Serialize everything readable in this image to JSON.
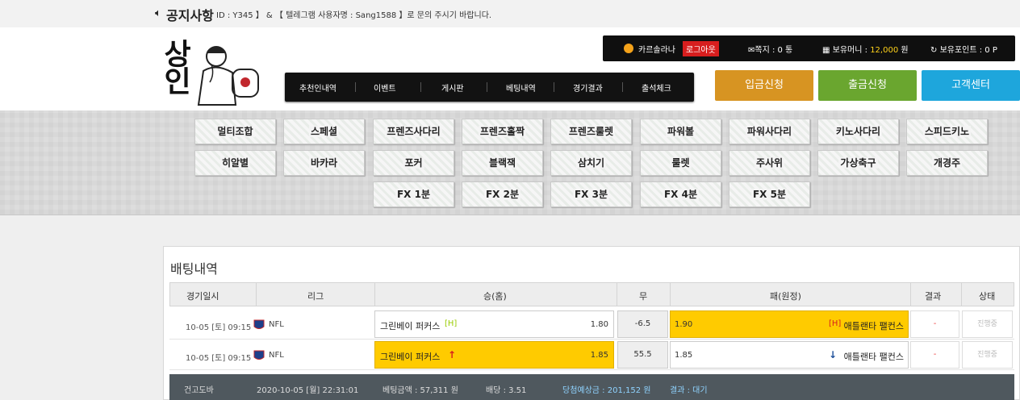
{
  "notice": {
    "icon": "speaker-icon",
    "title": "공지사항",
    "text": "ID : Y345 】 & 【 텔레그램 사용자명 : Sang1588 】로 문의 주시기 바랍니다."
  },
  "logo": {
    "text": "상인"
  },
  "userbar": {
    "username": "카르솔라나",
    "logout_label": "로그아웃",
    "message_label": "쪽지 : 0 통",
    "money_label": "보유머니 :",
    "money_value": "12,000",
    "money_unit": "원",
    "point_label": "보유포인트 : 0 P"
  },
  "menu": [
    "추천인내역",
    "이벤트",
    "게시판",
    "베팅내역",
    "경기결과",
    "출석체크"
  ],
  "actions": [
    {
      "label": "입금신청",
      "color": "#d79422"
    },
    {
      "label": "출금신청",
      "color": "#6aa62f"
    },
    {
      "label": "고객센터",
      "color": "#1ea6dc"
    }
  ],
  "games": [
    [
      "멀티조합",
      "스페셜",
      "프렌즈사다리",
      "프렌즈홀짝",
      "프렌즈룰렛",
      "파워볼",
      "파워사다리",
      "키노사다리",
      "스피드키노"
    ],
    [
      "히알별",
      "바카라",
      "포커",
      "블랙잭",
      "삼치기",
      "룰렛",
      "주사위",
      "가상축구",
      "개경주"
    ],
    [
      "FX 1분",
      "FX 2분",
      "FX 3분",
      "FX 4분",
      "FX 5분"
    ]
  ],
  "bet_history": {
    "title": "배팅내역",
    "columns": [
      "경기일시",
      "리그",
      "승(홈)",
      "무",
      "패(원정)",
      "결과",
      "상태"
    ],
    "rows": [
      {
        "date": "10-05 [토] 09:15",
        "league": "NFL",
        "home": "그린베이 퍼커스",
        "home_tag": "[H]",
        "home_odds": "1.80",
        "draw": "-6.5",
        "away_odds": "1.90",
        "away": "애틀랜타 팰컨스",
        "away_tag": "[H]",
        "result": "-",
        "status": "진행중",
        "selected": "away"
      },
      {
        "date": "10-05 [토] 09:15",
        "league": "NFL",
        "home": "그린베이 퍼커스",
        "home_tag": "↑",
        "home_odds": "1.85",
        "draw": "55.5",
        "away_odds": "1.85",
        "away": "애틀랜타 팰컨스",
        "away_tag": "↓",
        "result": "-",
        "status": "진행중",
        "selected": "home"
      }
    ],
    "summary": {
      "label": "건고도바",
      "datetime": "2020-10-05 [월] 22:31:01",
      "bet_amount": "베팅금액 : 57,311 원",
      "odds": "배당 : 3.51",
      "expected": "당첨예상금 : 201,152 원",
      "result": "결과 : 대기"
    }
  },
  "colors": {
    "highlight": "#ffcb00",
    "accent_red": "#d71e1e",
    "footer_bg": "#4f585e"
  }
}
